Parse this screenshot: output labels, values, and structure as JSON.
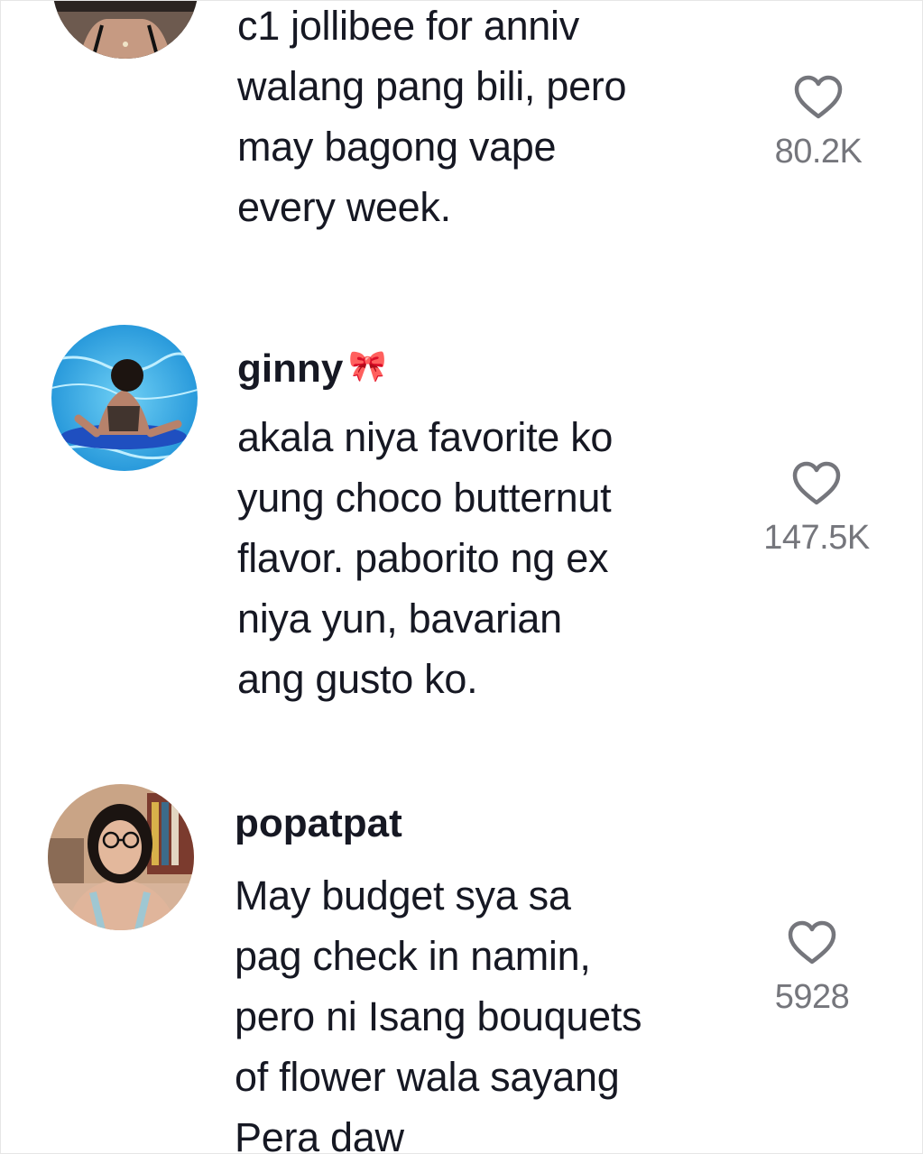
{
  "comments": [
    {
      "username": "",
      "text": "c1 jollibee for anniv\nwalang pang bili, pero\nmay bagong vape\nevery week.",
      "likes": "80.2K",
      "avatar_icon": "profile-photo-dark"
    },
    {
      "username": "ginny",
      "username_decoration": "🎀",
      "text": "akala niya favorite ko\nyung choco butternut\nflavor. paborito ng ex\nniya yun, bavarian\nang gusto ko.",
      "likes": "147.5K",
      "avatar_icon": "profile-photo-pool"
    },
    {
      "username": "popatpat",
      "text": "May budget sya sa\npag check in namin,\npero ni Isang bouquets\nof flower wala sayang\nPera daw",
      "likes": "5928",
      "avatar_icon": "profile-photo-glasses"
    }
  ],
  "icons": {
    "like": "heart-outline-icon"
  },
  "colors": {
    "text": "#161823",
    "muted": "#75767c",
    "heart_stroke": "#75767c"
  }
}
